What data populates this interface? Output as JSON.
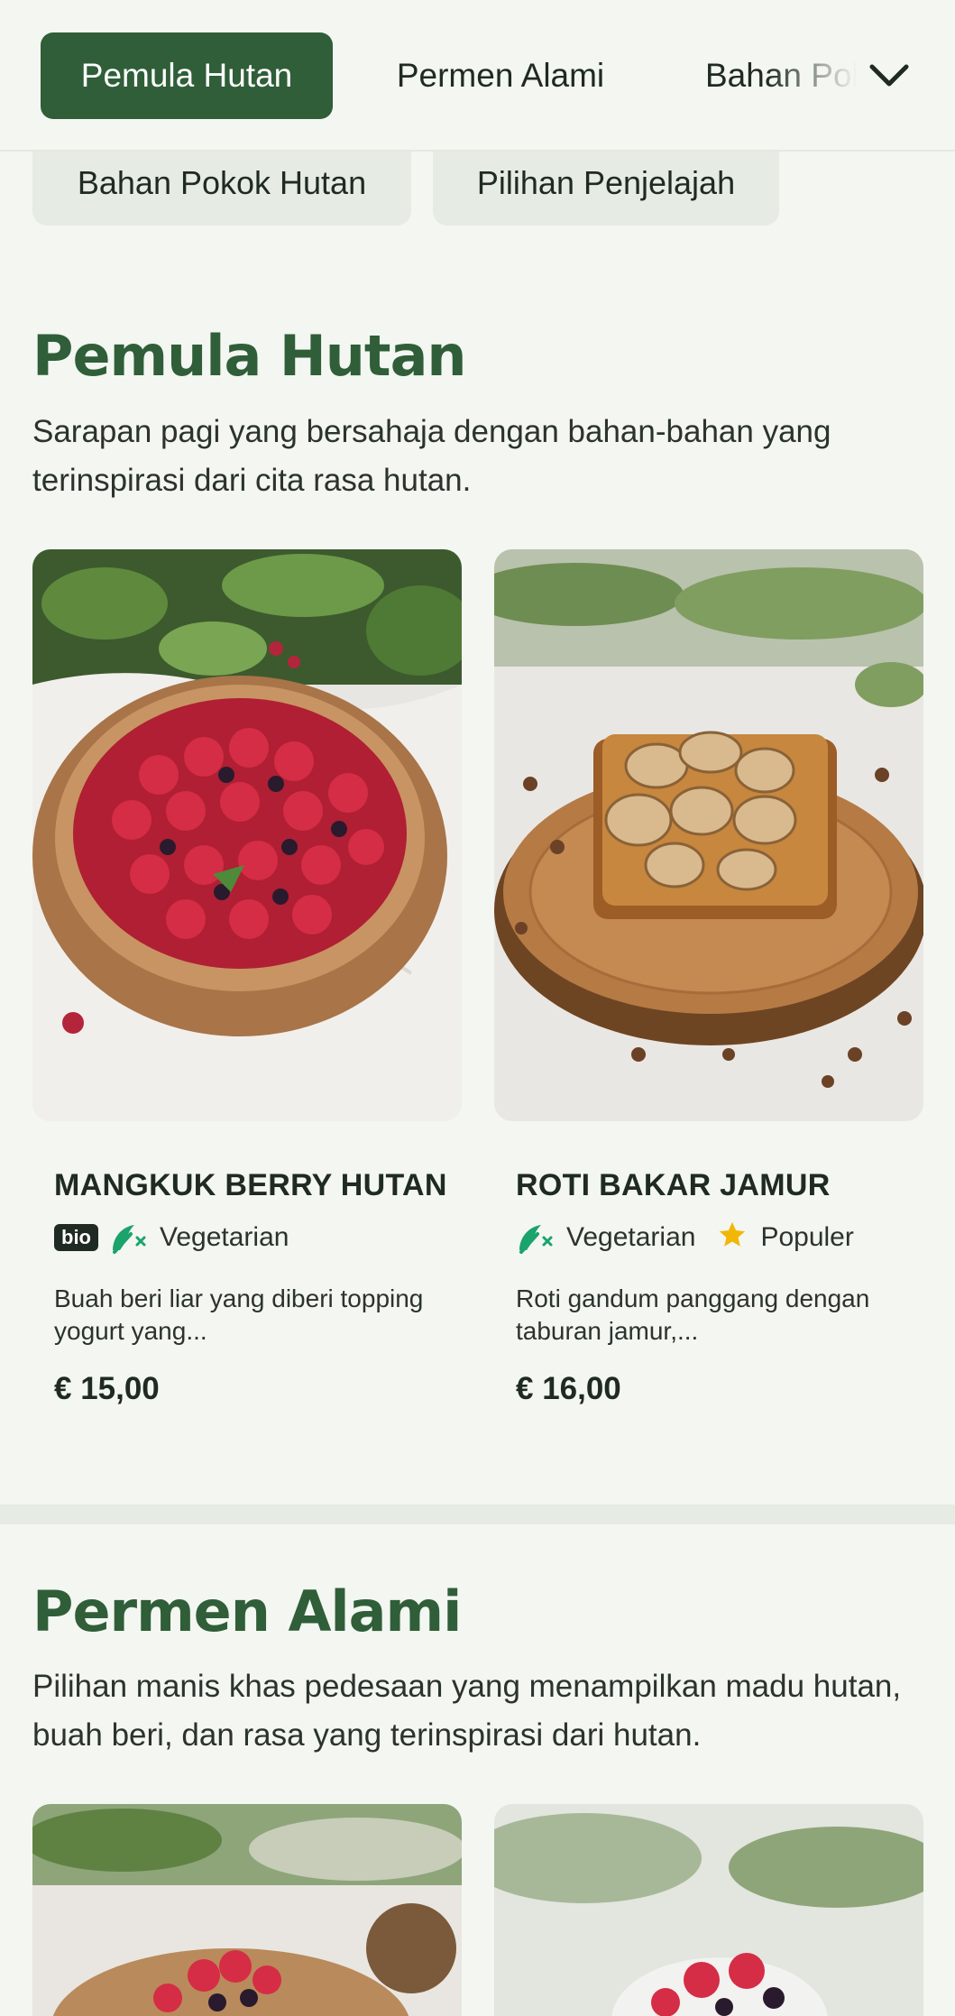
{
  "tabs": [
    {
      "label": "Pemula Hutan",
      "active": true
    },
    {
      "label": "Permen Alami",
      "active": false
    },
    {
      "label": "Bahan Pokok Hutan",
      "active": false
    }
  ],
  "subnav": [
    "Bahan Pokok Hutan",
    "Pilihan Penjelajah"
  ],
  "sections": [
    {
      "title": "Pemula Hutan",
      "description": "Sarapan pagi yang bersahaja dengan bahan-bahan yang terinspirasi dari cita rasa hutan.",
      "items": [
        {
          "name": "MANGKUK BERRY HUTAN",
          "badge": "bio",
          "tags": [
            {
              "icon": "vegetarian-icon",
              "label": "Vegetarian"
            }
          ],
          "description": "Buah beri liar yang diberi topping yogurt yang...",
          "price": "€ 15,00"
        },
        {
          "name": "ROTI BAKAR JAMUR",
          "tags": [
            {
              "icon": "vegetarian-icon",
              "label": "Vegetarian"
            },
            {
              "icon": "star-icon",
              "label": "Populer"
            }
          ],
          "description": "Roti gandum panggang dengan taburan jamur,...",
          "price": "€ 16,00"
        }
      ]
    },
    {
      "title": "Permen Alami",
      "description": "Pilihan manis khas pedesaan yang menampilkan madu hutan, buah beri, dan rasa yang terinspirasi dari hutan."
    }
  ],
  "colors": {
    "brand_green": "#2f5e38",
    "background": "#f3f6f1",
    "tag_green": "#1aa36b",
    "star_yellow": "#f2b705"
  }
}
